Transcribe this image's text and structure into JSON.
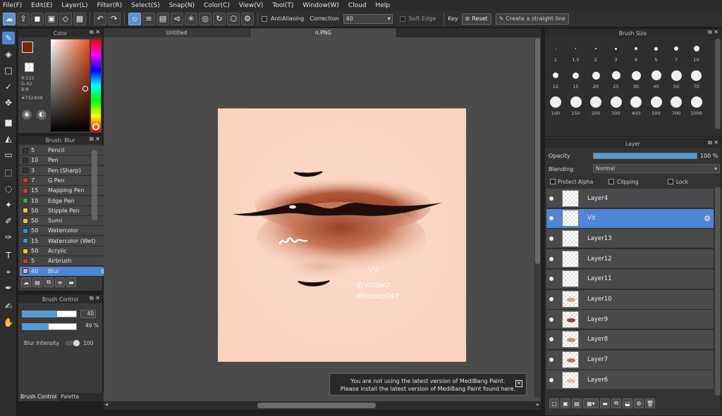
{
  "menu": [
    "File(F)",
    "Edit(E)",
    "Layer(L)",
    "Filter(R)",
    "Select(S)",
    "Snap(N)",
    "Color(C)",
    "View(V)",
    "Tool(T)",
    "Window(W)",
    "Cloud",
    "Help"
  ],
  "toolbar": {
    "antialias_label": "AntiAliasing",
    "correction_label": "Correction",
    "correction_value": "40",
    "softedge_label": "Soft Edge",
    "key_label": "Key",
    "reset_label": "Reset",
    "straight_line_label": "Create a straight line"
  },
  "color_panel": {
    "title": "Color",
    "r": "R:115",
    "g": "G:42",
    "b": "B:8",
    "hex": "#732A08",
    "primary": "#732a08"
  },
  "brush_panel": {
    "title": "Brush: Blur",
    "items": [
      {
        "size": "5",
        "name": "Pencil",
        "color": "#333333"
      },
      {
        "size": "10",
        "name": "Pen",
        "color": "#333333"
      },
      {
        "size": "3",
        "name": "Pen (Sharp)",
        "color": "#333333"
      },
      {
        "size": "7",
        "name": "G Pen",
        "color": "#e03030"
      },
      {
        "size": "15",
        "name": "Mapping Pen",
        "color": "#e03030"
      },
      {
        "size": "10",
        "name": "Edge Pen",
        "color": "#3aa83a"
      },
      {
        "size": "50",
        "name": "Stipple Pen",
        "color": "#e6c830"
      },
      {
        "size": "50",
        "name": "Sumi",
        "color": "#e6c830"
      },
      {
        "size": "50",
        "name": "Watercolor",
        "color": "#3a8fd8"
      },
      {
        "size": "15",
        "name": "Watercolor (Wet)",
        "color": "#3a8fd8"
      },
      {
        "size": "50",
        "name": "Acrylic",
        "color": "#e6c830"
      },
      {
        "size": "5",
        "name": "Airbrush",
        "color": "#e03030"
      },
      {
        "size": "40",
        "name": "Blur",
        "color": "#e8a0e8"
      }
    ]
  },
  "brush_control": {
    "title": "Brush Control",
    "size": "40",
    "opacity": "49 %",
    "size_fill": 0.65,
    "opacity_fill": 0.49,
    "blur_label": "Blur Intensity",
    "blur_value": "100",
    "tab1": "Brush Control",
    "tab2": "Palette"
  },
  "tabs": [
    "Untitled",
    "n.PNG"
  ],
  "canvas": {
    "watermark1": "Vịt",
    "watermark2": "@VitOwO",
    "watermark3": "#hoidap247"
  },
  "notification": {
    "line1": "You are not using the latest version of MediBang Paint.",
    "line2": "Please install the latest version of MediBang Paint found here."
  },
  "brush_size": {
    "title": "Brush Size",
    "sizes": [
      "1",
      "1.5",
      "2",
      "3",
      "4",
      "5",
      "7",
      "10",
      "12",
      "15",
      "20",
      "25",
      "30",
      "40",
      "50",
      "70",
      "100",
      "150",
      "200",
      "300",
      "400",
      "500",
      "700",
      "1000"
    ]
  },
  "layer_panel": {
    "title": "Layer",
    "opacity_label": "Opacity",
    "opacity_value": "100 %",
    "opacity_fill": 1.0,
    "blending_label": "Blending",
    "blending_value": "Normal",
    "protect_alpha": "Protect Alpha",
    "clipping": "Clipping",
    "lock": "Lock",
    "layers": [
      "Layer4",
      "Vịt",
      "Layer13",
      "Layer12",
      "Layer11",
      "Layer10",
      "Layer9",
      "Layer8",
      "Layer7",
      "Layer6"
    ],
    "selected_index": 1
  }
}
